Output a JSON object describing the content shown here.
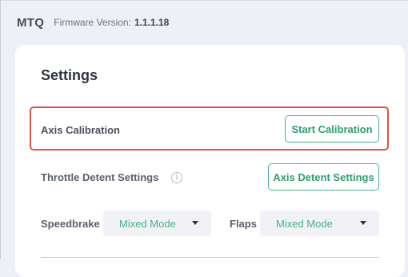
{
  "header": {
    "brand": "MTQ",
    "firmware_label": "Firmware Version:",
    "firmware_value": "1.1.1.18"
  },
  "settings": {
    "title": "Settings",
    "axis_calibration": {
      "label": "Axis Calibration",
      "button": "Start Calibration"
    },
    "throttle_detent": {
      "label": "Throttle Detent Settings",
      "info_icon": "info-icon",
      "button": "Axis Detent Settings"
    },
    "speedbrake": {
      "label": "Speedbrake",
      "value": "Mixed Mode"
    },
    "flaps": {
      "label": "Flaps",
      "value": "Mixed Mode"
    }
  },
  "colors": {
    "accent": "#2e9e6e",
    "highlight": "#d9534f",
    "background": "#eef0f5"
  }
}
